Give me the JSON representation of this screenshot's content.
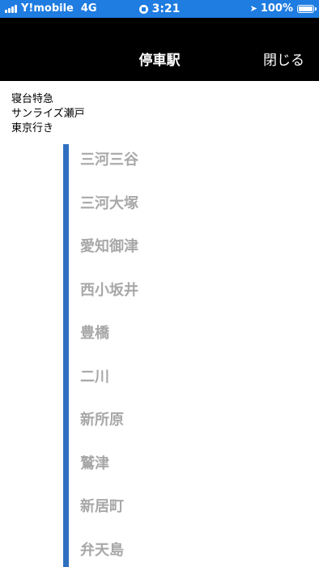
{
  "status_bar": {
    "carrier": "Y!mobile",
    "network": "4G",
    "time": "3:21",
    "battery": "100%"
  },
  "nav": {
    "title": "停車駅",
    "close_label": "閉じる"
  },
  "train": {
    "line1": "寝台特急",
    "line2": "サンライズ瀬戸",
    "line3": "東京行き"
  },
  "stations": [
    "三河三谷",
    "三河大塚",
    "愛知御津",
    "西小坂井",
    "豊橋",
    "二川",
    "新所原",
    "鷲津",
    "新居町",
    "弁天島"
  ],
  "colors": {
    "status_bar": "#1f7ce0",
    "nav_bar": "#000000",
    "timeline": "#2f6fc0",
    "station_text": "#a8a8a8"
  }
}
